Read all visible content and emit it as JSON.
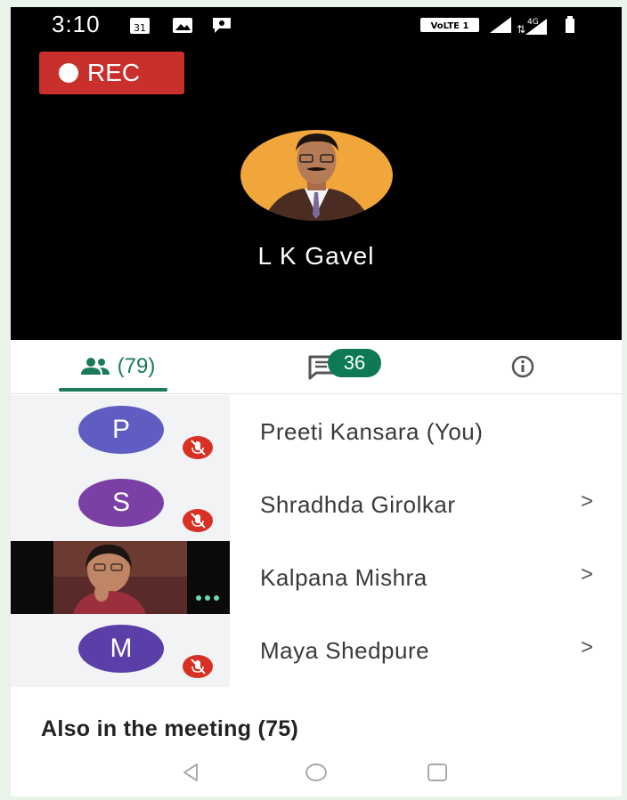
{
  "status_bar": {
    "time": "3:10",
    "calendar_day": "31",
    "network": "VoLTE 1",
    "network_type": "4G"
  },
  "recording": {
    "label": "REC"
  },
  "presenter": {
    "name": "L K Gavel"
  },
  "tabs": {
    "people_count": "(79)",
    "chat_badge": "36"
  },
  "participants": [
    {
      "initial": "P",
      "name": "Preeti Kansara (You)",
      "avatar_color": "#5f5cc2",
      "muted": true,
      "video": false
    },
    {
      "initial": "S",
      "name": "Shradhda Girolkar",
      "avatar_color": "#7b3fa6",
      "muted": true,
      "video": false
    },
    {
      "initial": "",
      "name": "Kalpana Mishra",
      "avatar_color": "#000000",
      "muted": false,
      "video": true
    },
    {
      "initial": "M",
      "name": "Maya Shedpure",
      "avatar_color": "#5b3ea8",
      "muted": true,
      "video": false
    }
  ],
  "also_in_meeting": "Also in the meeting (75)",
  "colors": {
    "accent": "#1a7a5a",
    "rec": "#c9302c",
    "mute": "#d93025"
  }
}
